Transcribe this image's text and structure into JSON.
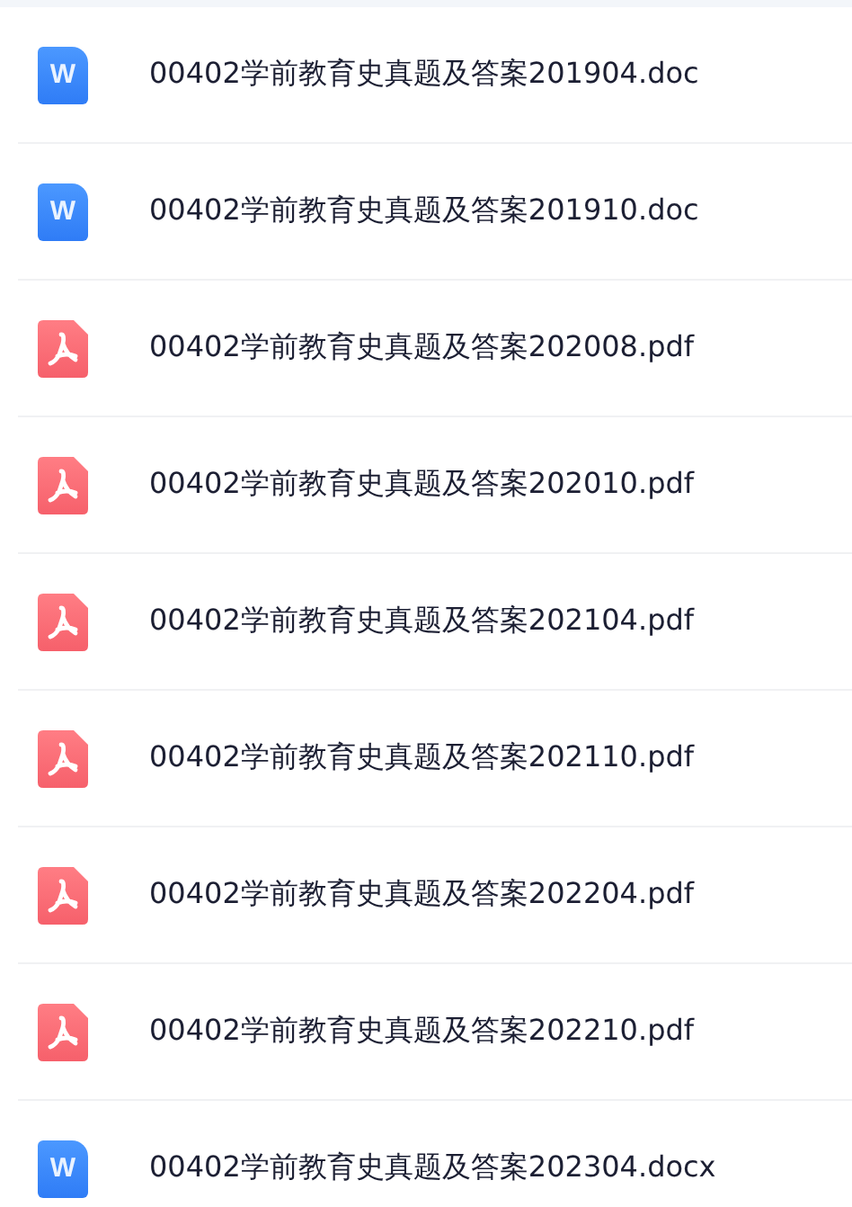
{
  "files": [
    {
      "name": "00402学前教育史真题及答案201904.doc",
      "kind": "word",
      "icon_label": "W"
    },
    {
      "name": "00402学前教育史真题及答案201910.doc",
      "kind": "word",
      "icon_label": "W"
    },
    {
      "name": "00402学前教育史真题及答案202008.pdf",
      "kind": "pdf"
    },
    {
      "name": "00402学前教育史真题及答案202010.pdf",
      "kind": "pdf"
    },
    {
      "name": "00402学前教育史真题及答案202104.pdf",
      "kind": "pdf"
    },
    {
      "name": "00402学前教育史真题及答案202110.pdf",
      "kind": "pdf"
    },
    {
      "name": "00402学前教育史真题及答案202204.pdf",
      "kind": "pdf"
    },
    {
      "name": "00402学前教育史真题及答案202210.pdf",
      "kind": "pdf"
    },
    {
      "name": "00402学前教育史真题及答案202304.docx",
      "kind": "word",
      "icon_label": "W"
    }
  ]
}
